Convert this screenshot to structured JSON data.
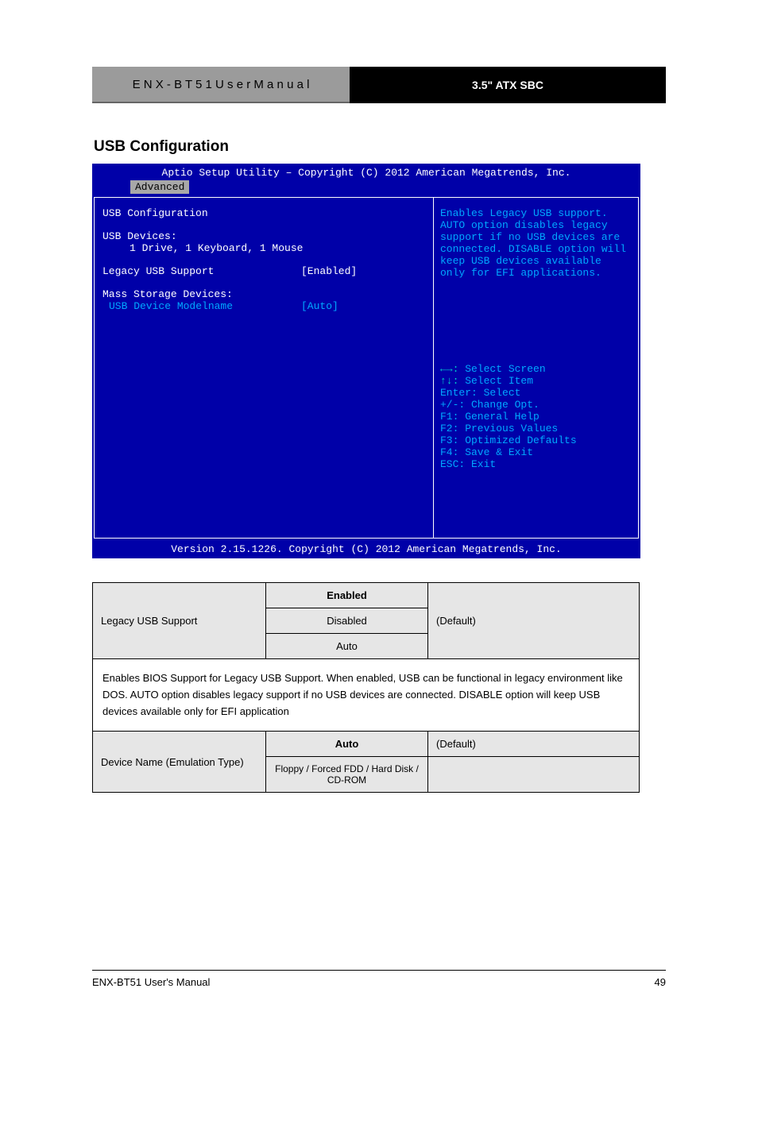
{
  "header": {
    "left": "E N X - B T 5 1   U s e r   M a n u a l",
    "right": "3.5\" ATX SBC"
  },
  "section_title": "USB Configuration",
  "bios": {
    "title": "Aptio Setup Utility – Copyright (C) 2012 American Megatrends, Inc.",
    "tab": "Advanced",
    "heading": "USB Configuration",
    "devices_label": "USB Devices:",
    "devices_value": "1 Drive, 1 Keyboard, 1 Mouse",
    "legacy_label": "Legacy USB Support",
    "legacy_value": "[Enabled]",
    "mass_label": "Mass Storage Devices:",
    "mass_item_label": "USB Device Modelname",
    "mass_item_value": "[Auto]",
    "help": "Enables Legacy USB support. AUTO option disables legacy support if no USB devices are connected. DISABLE option will keep USB devices available only for EFI applications.",
    "nav": {
      "l1a": "←→:",
      "l1b": " Select Screen",
      "l2a": "↑↓:",
      "l2b": " Select Item",
      "l3": "Enter: Select",
      "l4": "+/-: Change Opt.",
      "l5": "F1: General Help",
      "l6": "F2: Previous Values",
      "l7": "F3: Optimized Defaults",
      "l8": "F4: Save & Exit",
      "l9": "ESC: Exit"
    },
    "footer": "Version 2.15.1226. Copyright (C) 2012 American Megatrends, Inc."
  },
  "table": {
    "r1c1": "Legacy USB Support",
    "r1o1": "Enabled",
    "r1o2": "Disabled",
    "r1o3": "Auto",
    "r1c3": "(Default)",
    "note": "Enables BIOS Support for Legacy USB Support. When enabled, USB can be functional in legacy environment like DOS. AUTO option disables legacy support if no USB devices are connected. DISABLE option will keep USB devices available only for EFI application",
    "r2c1": "Device Name (Emulation Type)",
    "r2o1": "Auto",
    "r2o2": "Floppy / Forced FDD / Hard Disk / CD-ROM",
    "r2c3": "(Default)"
  },
  "footer": {
    "left": "ENX-BT51 User's Manual",
    "right": "49"
  }
}
